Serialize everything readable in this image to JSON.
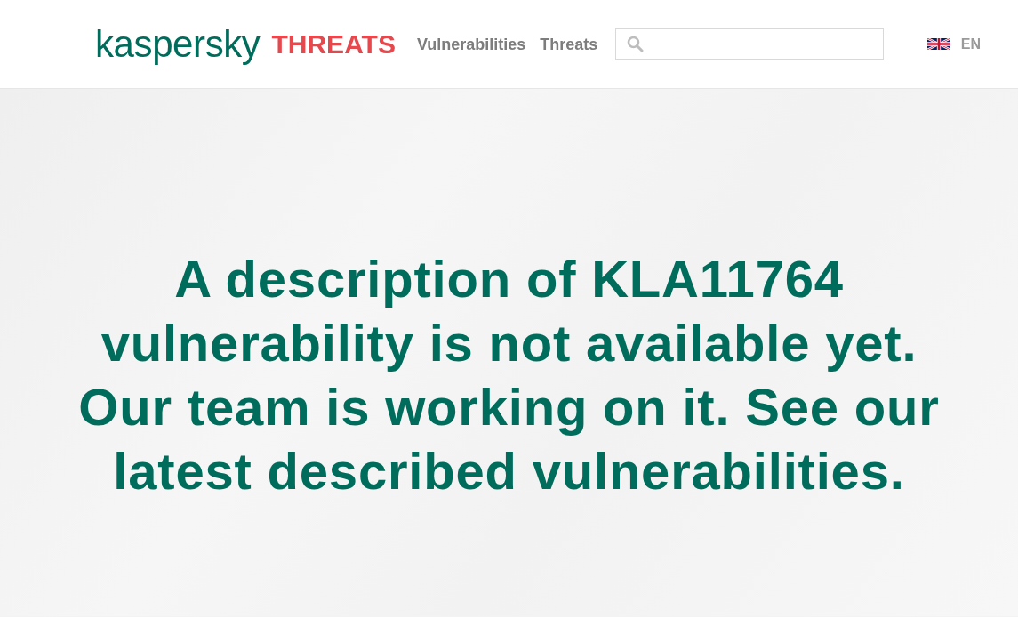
{
  "header": {
    "logo": {
      "brand": "kaspersky",
      "product": "THREATS"
    },
    "nav": [
      {
        "label": "Vulnerabilities"
      },
      {
        "label": "Threats"
      }
    ],
    "language": {
      "label": "EN"
    }
  },
  "message": "A description of KLA11764 vulnerability is not available yet. Our team is working on it. See our latest described vulnerabilities."
}
